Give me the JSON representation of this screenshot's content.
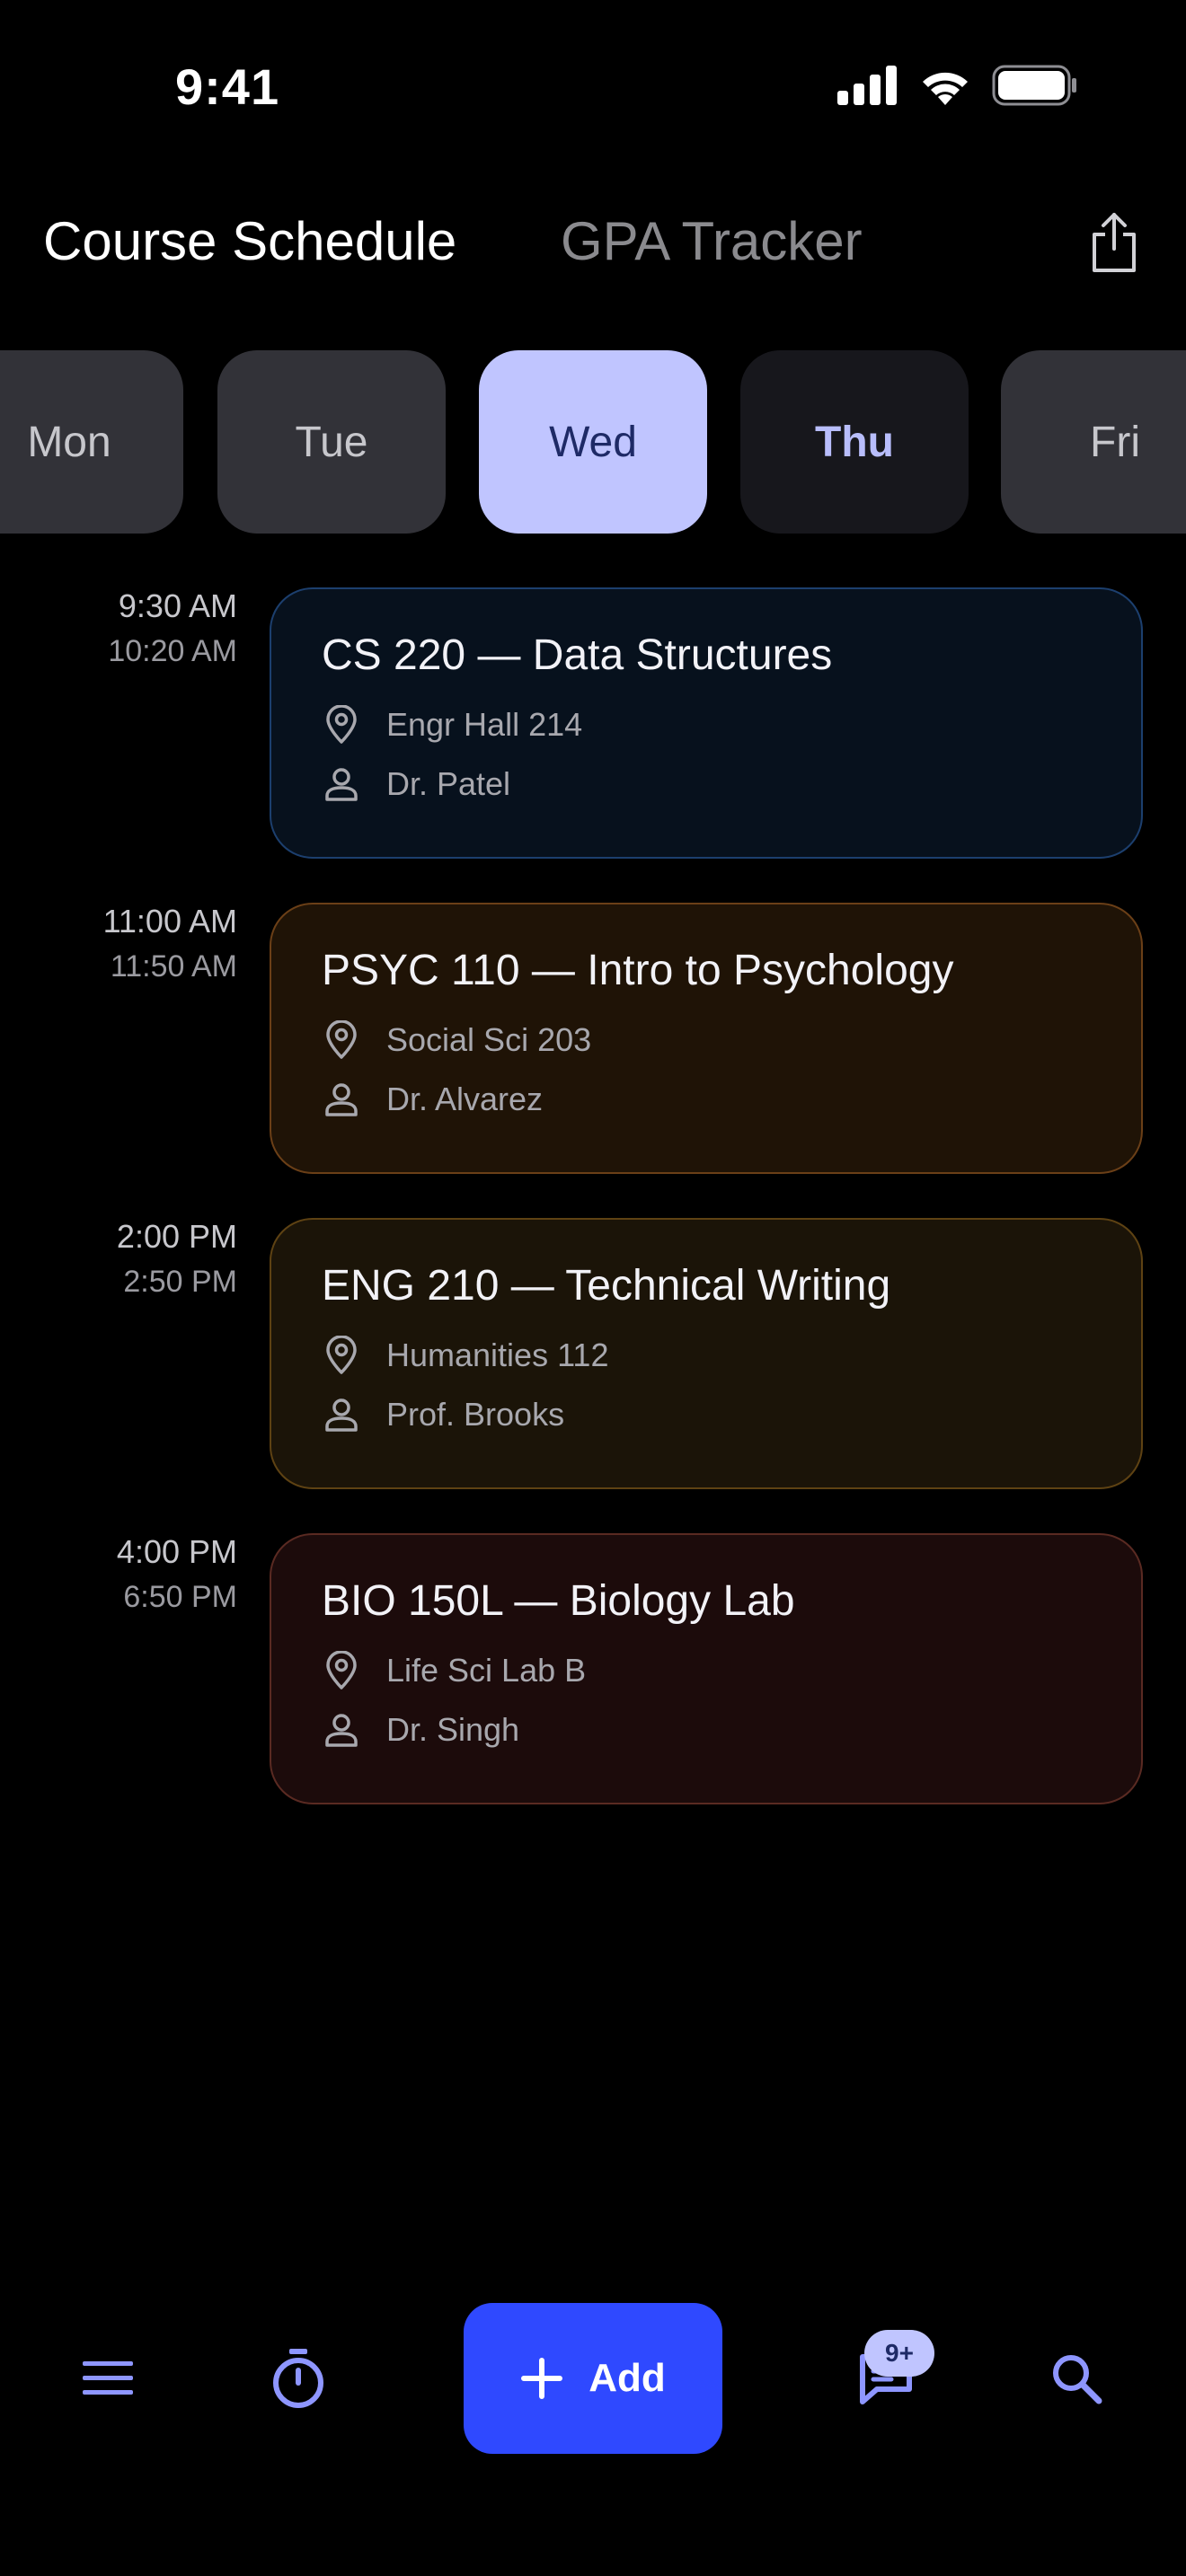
{
  "status_bar": {
    "time": "9:41",
    "icons": [
      "cellular-signal-icon",
      "wifi-icon",
      "battery-icon"
    ]
  },
  "header": {
    "tabs": [
      {
        "label": "Course Schedule",
        "active": true
      },
      {
        "label": "GPA Tracker",
        "active": false
      }
    ],
    "share_icon": "share-icon"
  },
  "days": [
    {
      "label": "Mon",
      "state": "normal"
    },
    {
      "label": "Tue",
      "state": "normal"
    },
    {
      "label": "Wed",
      "state": "selected"
    },
    {
      "label": "Thu",
      "state": "today"
    },
    {
      "label": "Fri",
      "state": "normal"
    }
  ],
  "classes": [
    {
      "start": "9:30 AM",
      "end": "10:20 AM",
      "title": "CS 220 — Data Structures",
      "location": "Engr Hall 214",
      "instructor": "Dr. Patel",
      "card_bg": "#07111d",
      "card_border": "#1c3f6e"
    },
    {
      "start": "11:00 AM",
      "end": "11:50 AM",
      "title": "PSYC 110 — Intro to Psychology",
      "location": "Social Sci 203",
      "instructor": "Dr. Alvarez",
      "card_bg": "#1f1306",
      "card_border": "#6b3f17"
    },
    {
      "start": "2:00 PM",
      "end": "2:50 PM",
      "title": "ENG 210 — Technical Writing",
      "location": "Humanities 112",
      "instructor": "Prof. Brooks",
      "card_bg": "#1b1408",
      "card_border": "#5e4213"
    },
    {
      "start": "4:00 PM",
      "end": "6:50 PM",
      "title": "BIO 150L — Biology Lab",
      "location": "Life Sci Lab B",
      "instructor": "Dr. Singh",
      "card_bg": "#1c0b0b",
      "card_border": "#5a2a22"
    }
  ],
  "bottom_bar": {
    "menu_icon": "menu-icon",
    "timer_icon": "timer-icon",
    "add_label": "Add",
    "messages_icon": "messages-icon",
    "messages_badge": "9+",
    "search_icon": "search-icon",
    "accent": "#2f49ff",
    "icon_color": "#8e96ff"
  }
}
